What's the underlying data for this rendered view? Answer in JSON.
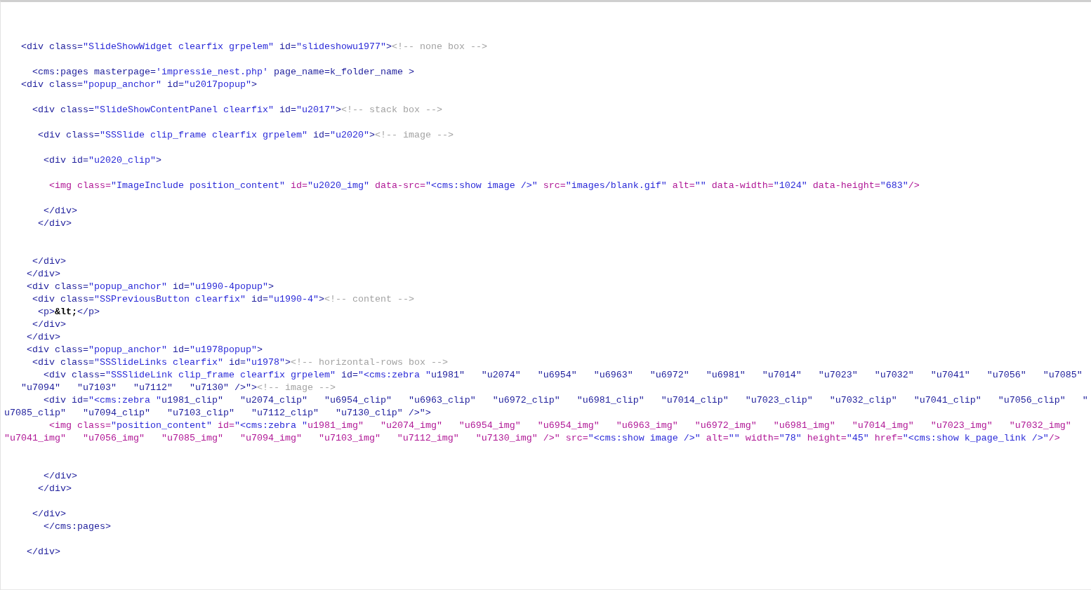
{
  "editor": {
    "lines": [
      {
        "kind": "code",
        "segments": [
          {
            "kind": "tag",
            "text": "   <div class="
          },
          {
            "kind": "value",
            "text": "\"SlideShowWidget clearfix grpelem\""
          },
          {
            "kind": "tag",
            "text": " id="
          },
          {
            "kind": "value",
            "text": "\"slideshowu1977\""
          },
          {
            "kind": "tag",
            "text": ">"
          },
          {
            "kind": "comment",
            "text": "<!-- none box -->"
          }
        ]
      },
      {
        "kind": "blank"
      },
      {
        "kind": "code",
        "segments": [
          {
            "kind": "tag",
            "text": "     <cms:pages masterpage="
          },
          {
            "kind": "value",
            "text": "'impressie_nest.php'"
          },
          {
            "kind": "tag",
            "text": " page_name=k_folder_name >"
          }
        ]
      },
      {
        "kind": "code",
        "segments": [
          {
            "kind": "tag",
            "text": "   <div class="
          },
          {
            "kind": "value",
            "text": "\"popup_anchor\""
          },
          {
            "kind": "tag",
            "text": " id="
          },
          {
            "kind": "value",
            "text": "\"u2017popup\""
          },
          {
            "kind": "tag",
            "text": ">"
          }
        ]
      },
      {
        "kind": "blank"
      },
      {
        "kind": "code",
        "segments": [
          {
            "kind": "tag",
            "text": "     <div class="
          },
          {
            "kind": "value",
            "text": "\"SlideShowContentPanel clearfix\""
          },
          {
            "kind": "tag",
            "text": " id="
          },
          {
            "kind": "value",
            "text": "\"u2017\""
          },
          {
            "kind": "tag",
            "text": ">"
          },
          {
            "kind": "comment",
            "text": "<!-- stack box -->"
          }
        ]
      },
      {
        "kind": "blank"
      },
      {
        "kind": "code",
        "segments": [
          {
            "kind": "tag",
            "text": "      <div class="
          },
          {
            "kind": "value",
            "text": "\"SSSlide clip_frame clearfix grpelem\""
          },
          {
            "kind": "tag",
            "text": " id="
          },
          {
            "kind": "value",
            "text": "\"u2020\""
          },
          {
            "kind": "tag",
            "text": ">"
          },
          {
            "kind": "comment",
            "text": "<!-- image -->"
          }
        ]
      },
      {
        "kind": "blank"
      },
      {
        "kind": "code",
        "segments": [
          {
            "kind": "tag",
            "text": "       <div id="
          },
          {
            "kind": "value",
            "text": "\"u2020_clip\""
          },
          {
            "kind": "tag",
            "text": ">"
          }
        ]
      },
      {
        "kind": "blank"
      },
      {
        "kind": "code",
        "segments": [
          {
            "kind": "img",
            "text": "        <img class="
          },
          {
            "kind": "value",
            "text": "\"ImageInclude position_content\""
          },
          {
            "kind": "img",
            "text": " id="
          },
          {
            "kind": "value",
            "text": "\"u2020_img\""
          },
          {
            "kind": "img",
            "text": " data-src="
          },
          {
            "kind": "value",
            "text": "\"<cms:show image />\""
          },
          {
            "kind": "img",
            "text": " src="
          },
          {
            "kind": "value",
            "text": "\"images/blank.gif\""
          },
          {
            "kind": "img",
            "text": " alt="
          },
          {
            "kind": "value",
            "text": "\"\""
          },
          {
            "kind": "img",
            "text": " data-width="
          },
          {
            "kind": "value",
            "text": "\"1024\""
          },
          {
            "kind": "img",
            "text": " data-height="
          },
          {
            "kind": "value",
            "text": "\"683\""
          },
          {
            "kind": "img",
            "text": "/>"
          }
        ]
      },
      {
        "kind": "blank"
      },
      {
        "kind": "code",
        "segments": [
          {
            "kind": "tag",
            "text": "       </div>"
          }
        ]
      },
      {
        "kind": "code",
        "segments": [
          {
            "kind": "tag",
            "text": "      </div>"
          }
        ]
      },
      {
        "kind": "blank"
      },
      {
        "kind": "blank"
      },
      {
        "kind": "code",
        "segments": [
          {
            "kind": "tag",
            "text": "     </div>"
          }
        ]
      },
      {
        "kind": "code",
        "segments": [
          {
            "kind": "tag",
            "text": "    </div>"
          }
        ]
      },
      {
        "kind": "code",
        "segments": [
          {
            "kind": "tag",
            "text": "    <div class="
          },
          {
            "kind": "value",
            "text": "\"popup_anchor\""
          },
          {
            "kind": "tag",
            "text": " id="
          },
          {
            "kind": "value",
            "text": "\"u1990-4popup\""
          },
          {
            "kind": "tag",
            "text": ">"
          }
        ]
      },
      {
        "kind": "code",
        "segments": [
          {
            "kind": "tag",
            "text": "     <div class="
          },
          {
            "kind": "value",
            "text": "\"SSPreviousButton clearfix\""
          },
          {
            "kind": "tag",
            "text": " id="
          },
          {
            "kind": "value",
            "text": "\"u1990-4\""
          },
          {
            "kind": "tag",
            "text": ">"
          },
          {
            "kind": "comment",
            "text": "<!-- content -->"
          }
        ]
      },
      {
        "kind": "code",
        "segments": [
          {
            "kind": "tag",
            "text": "      <p>"
          },
          {
            "kind": "entity",
            "text": "&lt;"
          },
          {
            "kind": "tag",
            "text": "</p>"
          }
        ]
      },
      {
        "kind": "code",
        "segments": [
          {
            "kind": "tag",
            "text": "     </div>"
          }
        ]
      },
      {
        "kind": "code",
        "segments": [
          {
            "kind": "tag",
            "text": "    </div>"
          }
        ]
      },
      {
        "kind": "code",
        "segments": [
          {
            "kind": "tag",
            "text": "    <div class="
          },
          {
            "kind": "value",
            "text": "\"popup_anchor\""
          },
          {
            "kind": "tag",
            "text": " id="
          },
          {
            "kind": "value",
            "text": "\"u1978popup\""
          },
          {
            "kind": "tag",
            "text": ">"
          }
        ]
      },
      {
        "kind": "code",
        "segments": [
          {
            "kind": "tag",
            "text": "     <div class="
          },
          {
            "kind": "value",
            "text": "\"SSSlideLinks clearfix\""
          },
          {
            "kind": "tag",
            "text": " id="
          },
          {
            "kind": "value",
            "text": "\"u1978\""
          },
          {
            "kind": "tag",
            "text": ">"
          },
          {
            "kind": "comment",
            "text": "<!-- horizontal-rows box -->"
          }
        ]
      },
      {
        "kind": "code",
        "segments": [
          {
            "kind": "tag",
            "text": "       <div class="
          },
          {
            "kind": "value",
            "text": "\"SSSlideLink clip_frame clearfix grpelem\""
          },
          {
            "kind": "tag",
            "text": " id="
          },
          {
            "kind": "value",
            "text": "\"<cms:zebra \""
          },
          {
            "kind": "tag",
            "text": "u1981\"   \"u2074\"   \"u6954\"   \"u6963\"   \"u6972\"   \"u6981\"   \"u7014\"   \"u7023\"   \"u7032\"   \"u7041\"   \"u7056\"   \"u7085\""
          }
        ]
      },
      {
        "kind": "code",
        "segments": [
          {
            "kind": "tag",
            "text": "   \"u7094\"   \"u7103\"   \"u7112\"   \"u7130\" />\">"
          },
          {
            "kind": "comment",
            "text": "<!-- image -->"
          }
        ]
      },
      {
        "kind": "code",
        "segments": [
          {
            "kind": "tag",
            "text": "       <div id="
          },
          {
            "kind": "value",
            "text": "\"<cms:zebra \""
          },
          {
            "kind": "tag",
            "text": "u1981_clip\"   \"u2074_clip\"   \"u6954_clip\"   \"u6963_clip\"   \"u6972_clip\"   \"u6981_clip\"   \"u7014_clip\"   \"u7023_clip\"   \"u7032_clip\"   \"u7041_clip\"   \"u7056_clip\"   \""
          }
        ]
      },
      {
        "kind": "code",
        "segments": [
          {
            "kind": "tag",
            "text": "u7085_clip\"   \"u7094_clip\"   \"u7103_clip\"   \"u7112_clip\"   \"u7130_clip\" />\">"
          }
        ]
      },
      {
        "kind": "code",
        "segments": [
          {
            "kind": "img",
            "text": "        <img class="
          },
          {
            "kind": "value",
            "text": "\"position_content\""
          },
          {
            "kind": "img",
            "text": " id="
          },
          {
            "kind": "value",
            "text": "\"<cms:zebra \""
          },
          {
            "kind": "img",
            "text": "u1981_img\"   \"u2074_img\"   \"u6954_img\"   \"u6954_img\"   \"u6963_img\"   \"u6972_img\"   \"u6981_img\"   \"u7014_img\"   \"u7023_img\"   \"u7032_img\""
          }
        ]
      },
      {
        "kind": "code",
        "segments": [
          {
            "kind": "img",
            "text": "\"u7041_img\"   \"u7056_img\"   \"u7085_img\"   \"u7094_img\"   \"u7103_img\"   \"u7112_img\"   \"u7130_img\" />\" src="
          },
          {
            "kind": "value",
            "text": "\"<cms:show image />\""
          },
          {
            "kind": "img",
            "text": " alt="
          },
          {
            "kind": "value",
            "text": "\"\""
          },
          {
            "kind": "img",
            "text": " width="
          },
          {
            "kind": "value",
            "text": "\"78\""
          },
          {
            "kind": "img",
            "text": " height="
          },
          {
            "kind": "value",
            "text": "\"45\""
          },
          {
            "kind": "img",
            "text": " href="
          },
          {
            "kind": "value",
            "text": "\"<cms:show k_page_link />\""
          },
          {
            "kind": "img",
            "text": "/>"
          }
        ]
      },
      {
        "kind": "blank"
      },
      {
        "kind": "blank"
      },
      {
        "kind": "code",
        "segments": [
          {
            "kind": "tag",
            "text": "       </div>"
          }
        ]
      },
      {
        "kind": "code",
        "segments": [
          {
            "kind": "tag",
            "text": "      </div>"
          }
        ]
      },
      {
        "kind": "blank"
      },
      {
        "kind": "code",
        "segments": [
          {
            "kind": "tag",
            "text": "     </div>"
          }
        ]
      },
      {
        "kind": "code",
        "segments": [
          {
            "kind": "tag",
            "text": "       </cms:pages>"
          }
        ]
      },
      {
        "kind": "blank"
      },
      {
        "kind": "code",
        "segments": [
          {
            "kind": "tag",
            "text": "    </div>"
          }
        ]
      }
    ]
  }
}
